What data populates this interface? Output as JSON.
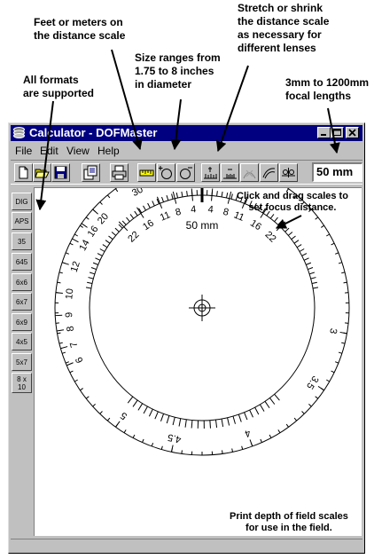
{
  "callouts": {
    "distance_scale": "Feet or meters on\nthe distance scale",
    "size_ranges": "Size ranges from\n1.75 to 8 inches\nin diameter",
    "stretch": "Stretch or shrink\nthe distance scale\nas necessary for\ndifferent lenses",
    "formats": "All formats\nare supported",
    "focal_lengths": "3mm to 1200mm\nfocal lengths"
  },
  "window": {
    "title": "Calculator - DOFMaster",
    "menu": [
      "File",
      "Edit",
      "View",
      "Help"
    ],
    "focal_length_value": "50 mm"
  },
  "toolbar_icons": [
    "new-document-icon",
    "open-folder-icon",
    "save-disk-icon",
    "copy-icon",
    "print-icon",
    "ruler-units-icon",
    "enlarge-scale-icon",
    "shrink-scale-icon",
    "stretch-scale-icon",
    "compress-scale-icon",
    "curve-icon",
    "hyperfocal-icon"
  ],
  "formats": [
    "DIG",
    "APS",
    "35",
    "645",
    "6x6",
    "6x7",
    "6x9",
    "4x5",
    "5x7",
    "8 x\n10"
  ],
  "canvas": {
    "drag_hint": "Click and drag scales to\nset focus distance.",
    "print_hint": "Print depth of field scales\nfor use in the field."
  },
  "dial": {
    "distance_unit": "feet",
    "lens_label": "50 mm",
    "distance_labels": [
      "3",
      "3.5",
      "4",
      "4.5",
      "5",
      "6",
      "7",
      "8",
      "9",
      "10",
      "12",
      "14",
      "16",
      "20",
      "30",
      "50",
      "100",
      "∞"
    ],
    "aperture_labels_left": [
      "22",
      "16",
      "11",
      "8",
      "4"
    ],
    "aperture_labels_right": [
      "4",
      "8",
      "11",
      "16",
      "22"
    ]
  }
}
